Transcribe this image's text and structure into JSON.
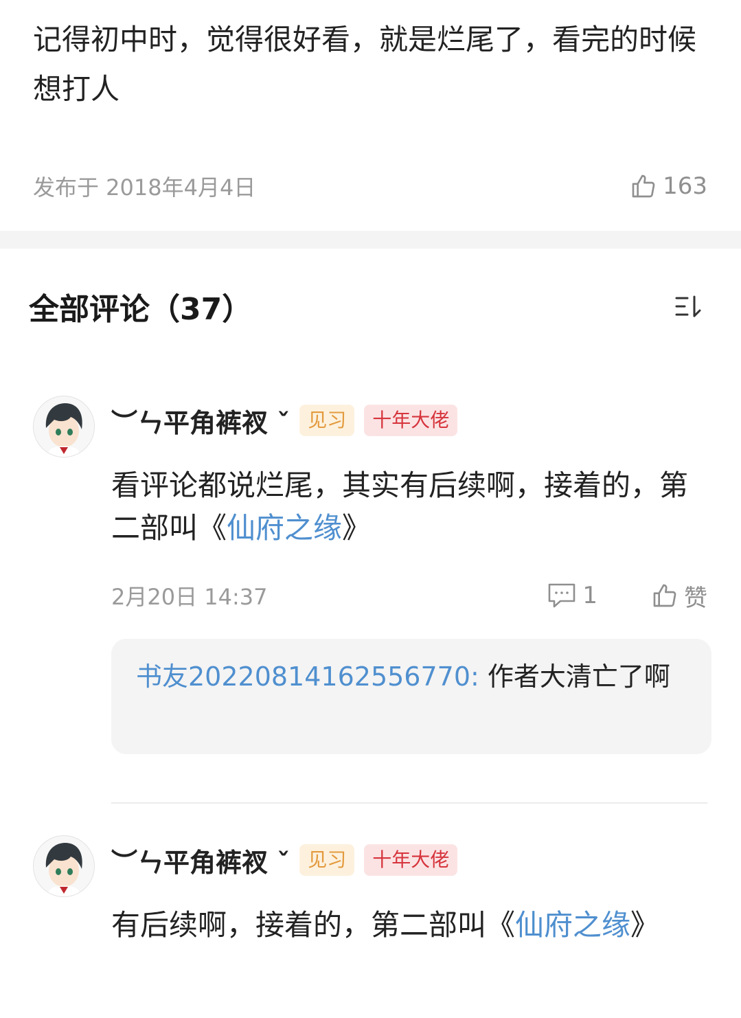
{
  "post": {
    "text": "记得初中时，觉得很好看，就是烂尾了，看完的时候想打人",
    "date": "发布于 2018年4月4日",
    "like_count": "163"
  },
  "comments_section": {
    "title": "全部评论（37）"
  },
  "comments": [
    {
      "username": "︶ㄣ平角裤衩 ˇ",
      "badge_level": "见习",
      "badge_title": "十年大佬",
      "text_before": "看评论都说烂尾，其实有后续啊，接着的，第二部叫《",
      "link_text": "仙府之缘",
      "text_after": "》",
      "time": "2月20日 14:37",
      "reply_count": "1",
      "like_label": "赞",
      "reply": {
        "user": "书友20220814162556770:",
        "text": " 作者大清亡了啊"
      }
    },
    {
      "username": "︶ㄣ平角裤衩 ˇ",
      "badge_level": "见习",
      "badge_title": "十年大佬",
      "text_before": "有后续啊，接着的，第二部叫《",
      "link_text": "仙府之缘",
      "text_after": "》"
    }
  ],
  "colors": {
    "link": "#4f8fcf",
    "badge_level_bg": "#fdf1de",
    "badge_level_fg": "#e39a3d",
    "badge_title_bg": "#fbe3e4",
    "badge_title_fg": "#d6343c"
  }
}
